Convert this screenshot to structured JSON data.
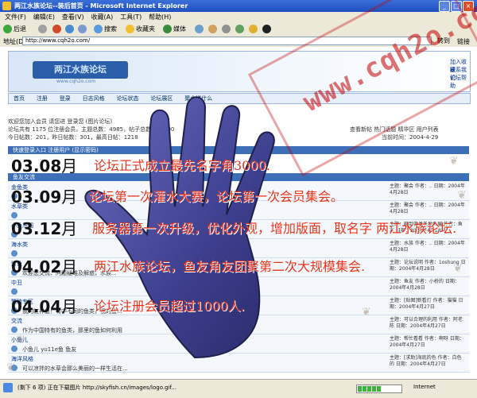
{
  "window": {
    "title": "两江水族论坛--装后首页 - Microsoft Internet Explorer"
  },
  "menu": {
    "items": [
      "文件(F)",
      "编辑(E)",
      "查看(V)",
      "收藏(A)",
      "工具(T)",
      "帮助(H)"
    ]
  },
  "toolbar": {
    "back": "后退",
    "search": "搜索",
    "favorites": "收藏夹",
    "media": "媒体"
  },
  "address": {
    "label": "地址(D)",
    "url": "http://www.cqh2o.com/",
    "go": "转到",
    "links": "链接"
  },
  "banner": {
    "logo": "两江水族论坛",
    "logo_sub": "www.cqh2o.com",
    "links": [
      "加入收藏",
      "联系我们",
      "论坛帮助"
    ]
  },
  "nav": {
    "items": [
      "首页",
      "注册",
      "登录",
      "日志风格",
      "论坛状态",
      "论坛展区",
      "聚会楼什么"
    ]
  },
  "info": {
    "welcome": "欢迎您加入会员 请您进 登录您 (图片论坛)",
    "stats1": "论坛共有 1175 位注册会员，主题总数：4985，帖子总数：50000",
    "stats2": "今日帖数：201，昨日帖数：301，最高日帖：1218",
    "right1": "查看新帖  热门话题  精华区  用户列表",
    "right2": "当前时间：2004-4-29"
  },
  "sections": {
    "quick": "快速登录入口  注册用户 (显示密码)",
    "forum": "鱼友交流"
  },
  "forums": [
    {
      "name": "金鱼类",
      "desc": "",
      "last": "主题：聚会 作者：.. 日期：2004年4月28日"
    },
    {
      "name": "水草类",
      "desc": "",
      "last": "主题：聚会 作者：.. 日期：2004年4月28日"
    },
    {
      "name": "小鱼乐园",
      "desc": "",
      "last": "主题：聊到各类各地鱼展 作者：鱼友 日期：2004年4月28日"
    },
    {
      "name": "海水类",
      "desc": "",
      "last": "主题：水族 作者：.. 日期：2004年4月28日"
    },
    {
      "name": "灯鱼",
      "desc": "欢迎您交流、问题疑难及解惑，水族...",
      "last": "主题：论坛说明 作者：1oshung 日期：2004年4月28日"
    },
    {
      "name": "中丑",
      "desc": "",
      "last": "主题：鱼友 作者：小桥的 日期：2004年4月28日"
    },
    {
      "name": "繁殖专区",
      "desc": "我的缸养鱼！有中不同的鱼类，我的鱼...",
      "last": "主题：[贴图]新看灯 作者：猫猫 日期：2004年4月27日"
    },
    {
      "name": "交流",
      "desc": "作为中国特有的鱼类，那里的鱼如何利用",
      "last": "主题：可以合理的利用 作者：阿老陈 日期：2004年4月27日"
    },
    {
      "name": "小鱼儿",
      "desc": "小鱼儿 yu11e鱼 鱼友",
      "last": "主题：帮忙看看 作者：啊呀 日期：2004年4月27日"
    },
    {
      "name": "海洋风格",
      "desc": "可以凉拌的水草会那么美丽的一样生活在...",
      "last": "主题：[求助]海底的色 作者：白色的 日期：2004年4月27日"
    }
  ],
  "watermark": {
    "text": "www.cqh2o.com"
  },
  "timeline": [
    {
      "date": "03.08",
      "month": "月",
      "text": "论坛正式成立最先名字角3000."
    },
    {
      "date": "03.09",
      "month": "月",
      "text": "论坛第一次灌水大赛，论坛第一次会员集会。"
    },
    {
      "date": "03.12",
      "month": "月",
      "text": "服务器第一次升级，优化外观，增加版面，取名字 两江水族论坛."
    },
    {
      "date": "04.02",
      "month": "月",
      "text": "两江水族论坛，鱼友角友团聚第二次大规模集会."
    },
    {
      "date": "04.04",
      "month": "月",
      "text": "论坛注册会员超过1000人."
    }
  ],
  "status": {
    "text": "(剩下 6 项) 正在下载图片 http://skyfish.cn/images/logo.gif...",
    "zone": "Internet",
    "progress": 0.55
  },
  "colors": {
    "timeline_text": "#e8331c",
    "hand": "#3d3f8f",
    "watermark": "#c40000",
    "section_bar": "#3d6fb8"
  }
}
